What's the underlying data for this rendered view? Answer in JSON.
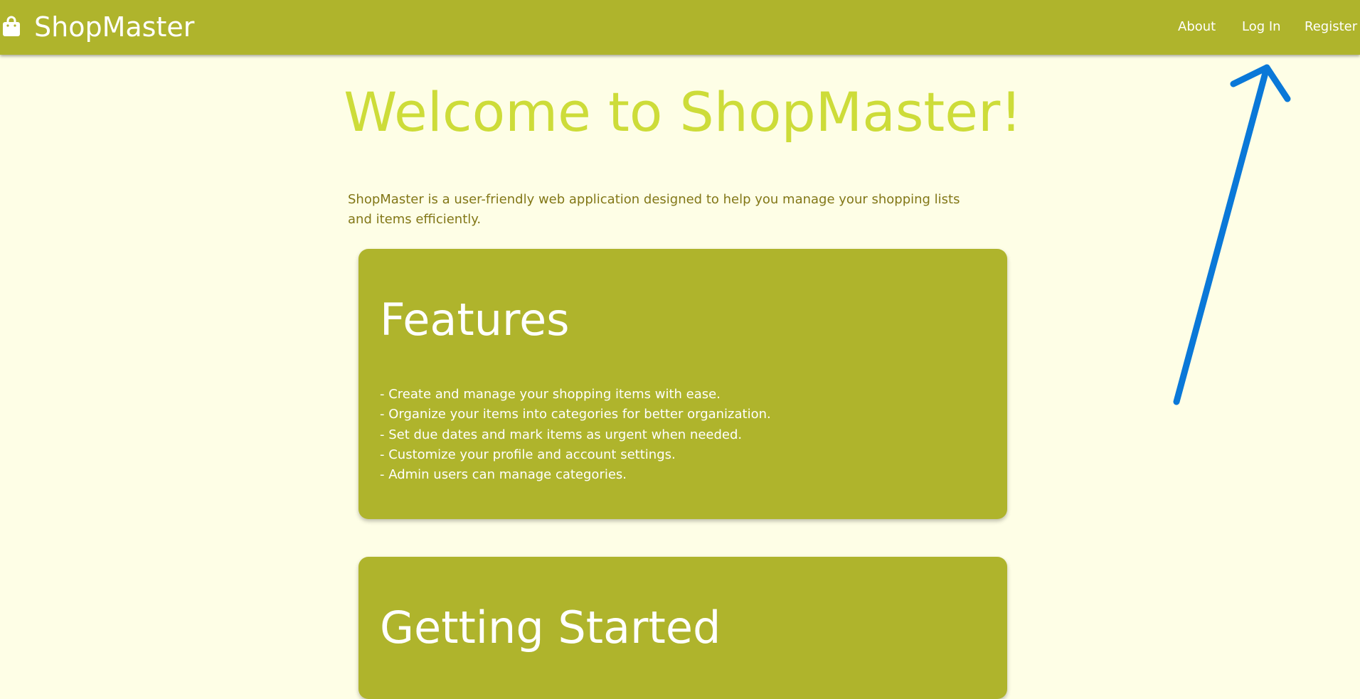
{
  "navbar": {
    "brand": "ShopMaster",
    "brand_icon": "shopping-bag-icon",
    "links": {
      "about": "About",
      "login": "Log In",
      "register": "Register"
    }
  },
  "hero": {
    "title": "Welcome to ShopMaster!",
    "intro": "ShopMaster is a user-friendly web application designed to help you manage your shopping lists and items efficiently."
  },
  "features": {
    "title": "Features",
    "items": [
      "- Create and manage your shopping items with ease.",
      "- Organize your items into categories for better organization.",
      "- Set due dates and mark items as urgent when needed.",
      "- Customize your profile and account settings.",
      "- Admin users can manage categories."
    ]
  },
  "getting_started": {
    "title": "Getting Started"
  },
  "colors": {
    "navbar": "#afb42c",
    "background": "#fefee6",
    "hero_title": "#cddc39",
    "intro_text": "#827717",
    "card": "#afb42c",
    "annotation_arrow": "#0a78d8"
  },
  "annotation": {
    "type": "arrow",
    "points_to": "nav-login-link"
  }
}
